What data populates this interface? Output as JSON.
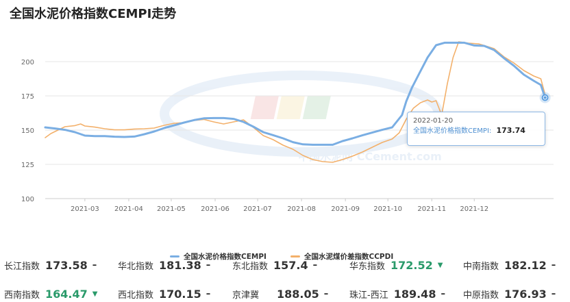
{
  "page": {
    "title": "全国水泥价格指数CEMPI走势"
  },
  "chart_data": {
    "type": "line",
    "title": "全国水泥价格指数CEMPI走势",
    "xlabel": "",
    "ylabel": "",
    "ylim": [
      100,
      220
    ],
    "yticks": [
      100,
      125,
      150,
      175,
      200
    ],
    "xlim": [
      "2021-02-01",
      "2022-01-26"
    ],
    "xticks": [
      "2021-03",
      "2021-04",
      "2021-05",
      "2021-06",
      "2021-07",
      "2021-08",
      "2021-09",
      "2021-10",
      "2021-11",
      "2021-12"
    ],
    "grid": "horizontal",
    "legend_position": "bottom",
    "watermark": "中国水泥网 CCement.com",
    "series": [
      {
        "name": "全国水泥价格指数CEMPI",
        "color": "#7aaee3",
        "points": [
          [
            "2021-02-01",
            152.0
          ],
          [
            "2021-02-08",
            151.2
          ],
          [
            "2021-02-15",
            150.2
          ],
          [
            "2021-02-22",
            148.5
          ],
          [
            "2021-03-01",
            146.0
          ],
          [
            "2021-03-08",
            145.6
          ],
          [
            "2021-03-15",
            145.6
          ],
          [
            "2021-03-22",
            145.2
          ],
          [
            "2021-03-29",
            145.0
          ],
          [
            "2021-04-05",
            145.3
          ],
          [
            "2021-04-12",
            147.0
          ],
          [
            "2021-04-19",
            149.0
          ],
          [
            "2021-04-26",
            151.5
          ],
          [
            "2021-05-03",
            153.5
          ],
          [
            "2021-05-10",
            155.5
          ],
          [
            "2021-05-17",
            157.3
          ],
          [
            "2021-05-24",
            158.6
          ],
          [
            "2021-05-31",
            158.8
          ],
          [
            "2021-06-07",
            158.8
          ],
          [
            "2021-06-14",
            158.2
          ],
          [
            "2021-06-21",
            156.0
          ],
          [
            "2021-06-28",
            152.5
          ],
          [
            "2021-07-05",
            148.5
          ],
          [
            "2021-07-12",
            146.3
          ],
          [
            "2021-07-19",
            144.0
          ],
          [
            "2021-07-26",
            141.2
          ],
          [
            "2021-08-02",
            139.6
          ],
          [
            "2021-08-09",
            139.3
          ],
          [
            "2021-08-16",
            139.3
          ],
          [
            "2021-08-23",
            139.3
          ],
          [
            "2021-08-30",
            142.0
          ],
          [
            "2021-09-06",
            144.0
          ],
          [
            "2021-09-13",
            146.2
          ],
          [
            "2021-09-20",
            148.2
          ],
          [
            "2021-09-27",
            150.2
          ],
          [
            "2021-10-04",
            152.0
          ],
          [
            "2021-10-11",
            161.0
          ],
          [
            "2021-10-14",
            171.0
          ],
          [
            "2021-10-18",
            181.0
          ],
          [
            "2021-10-23",
            191.0
          ],
          [
            "2021-10-29",
            203.0
          ],
          [
            "2021-11-04",
            212.0
          ],
          [
            "2021-11-10",
            213.8
          ],
          [
            "2021-11-17",
            213.8
          ],
          [
            "2021-11-24",
            213.8
          ],
          [
            "2021-12-01",
            211.8
          ],
          [
            "2021-12-08",
            211.5
          ],
          [
            "2021-12-15",
            208.5
          ],
          [
            "2021-12-22",
            202.5
          ],
          [
            "2021-12-29",
            197.0
          ],
          [
            "2022-01-05",
            190.5
          ],
          [
            "2022-01-12",
            186.0
          ],
          [
            "2022-01-17",
            183.0
          ],
          [
            "2022-01-20",
            173.74
          ]
        ]
      },
      {
        "name": "全国水泥煤价差指数CCPDI",
        "color": "#f3b06a",
        "points": [
          [
            "2021-02-01",
            144.5
          ],
          [
            "2021-02-05",
            147.5
          ],
          [
            "2021-02-10",
            150.0
          ],
          [
            "2021-02-15",
            152.5
          ],
          [
            "2021-02-22",
            153.3
          ],
          [
            "2021-02-26",
            154.5
          ],
          [
            "2021-03-01",
            153.0
          ],
          [
            "2021-03-08",
            152.2
          ],
          [
            "2021-03-15",
            151.0
          ],
          [
            "2021-03-22",
            150.2
          ],
          [
            "2021-03-29",
            150.2
          ],
          [
            "2021-04-05",
            150.8
          ],
          [
            "2021-04-12",
            151.0
          ],
          [
            "2021-04-19",
            151.5
          ],
          [
            "2021-04-26",
            153.5
          ],
          [
            "2021-05-03",
            155.0
          ],
          [
            "2021-05-10",
            155.5
          ],
          [
            "2021-05-17",
            157.0
          ],
          [
            "2021-05-24",
            157.8
          ],
          [
            "2021-05-31",
            156.0
          ],
          [
            "2021-06-07",
            154.5
          ],
          [
            "2021-06-14",
            156.0
          ],
          [
            "2021-06-21",
            157.5
          ],
          [
            "2021-06-28",
            152.0
          ],
          [
            "2021-07-05",
            146.0
          ],
          [
            "2021-07-12",
            143.0
          ],
          [
            "2021-07-19",
            139.0
          ],
          [
            "2021-07-26",
            136.0
          ],
          [
            "2021-08-02",
            131.5
          ],
          [
            "2021-08-09",
            128.5
          ],
          [
            "2021-08-16",
            127.0
          ],
          [
            "2021-08-23",
            126.5
          ],
          [
            "2021-08-30",
            128.5
          ],
          [
            "2021-09-06",
            131.0
          ],
          [
            "2021-09-13",
            134.0
          ],
          [
            "2021-09-20",
            137.5
          ],
          [
            "2021-09-27",
            141.0
          ],
          [
            "2021-10-04",
            143.5
          ],
          [
            "2021-10-09",
            148.0
          ],
          [
            "2021-10-14",
            158.0
          ],
          [
            "2021-10-19",
            166.0
          ],
          [
            "2021-10-24",
            170.0
          ],
          [
            "2021-10-29",
            172.0
          ],
          [
            "2021-11-01",
            170.5
          ],
          [
            "2021-11-04",
            171.5
          ],
          [
            "2021-11-08",
            161.0
          ],
          [
            "2021-11-12",
            184.0
          ],
          [
            "2021-11-16",
            203.0
          ],
          [
            "2021-11-20",
            214.5
          ],
          [
            "2021-11-27",
            213.5
          ],
          [
            "2021-12-04",
            213.0
          ],
          [
            "2021-12-08",
            211.8
          ],
          [
            "2021-12-15",
            209.5
          ],
          [
            "2021-12-22",
            203.5
          ],
          [
            "2021-12-29",
            199.0
          ],
          [
            "2022-01-05",
            193.5
          ],
          [
            "2022-01-12",
            189.5
          ],
          [
            "2022-01-17",
            187.5
          ],
          [
            "2022-01-20",
            176.0
          ]
        ]
      }
    ],
    "tooltip": {
      "date": "2022-01-20",
      "series": "全国水泥价格指数CEMPI",
      "separator": ":",
      "value": "173.74"
    }
  },
  "indices": {
    "row1": [
      {
        "name": "长江指数",
        "value": "173.58",
        "trend": "–"
      },
      {
        "name": "华北指数",
        "value": "181.38",
        "trend": "–"
      },
      {
        "name": "东北指数",
        "value": "157.4",
        "trend": "–"
      },
      {
        "name": "华东指数",
        "value": "172.52",
        "trend": "▼"
      },
      {
        "name": "中南指数",
        "value": "182.12",
        "trend": "–"
      }
    ],
    "row2": [
      {
        "name": "西南指数",
        "value": "164.47",
        "trend": "▼"
      },
      {
        "name": "西北指数",
        "value": "170.15",
        "trend": "–"
      },
      {
        "name": "京津冀",
        "value": "188.05",
        "trend": "–"
      },
      {
        "name": "珠江-西江",
        "value": "189.48",
        "trend": "–"
      },
      {
        "name": "中原指数",
        "value": "176.93",
        "trend": "–"
      }
    ]
  }
}
